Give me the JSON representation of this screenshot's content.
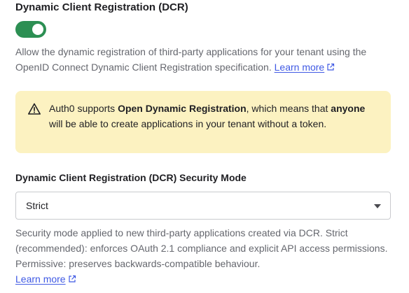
{
  "dcr": {
    "title": "Dynamic Client Registration (DCR)",
    "toggle_on": true,
    "description": "Allow the dynamic registration of third-party applications for your tenant using the OpenID Connect Dynamic Client Registration specification.",
    "learn_more": "Learn more"
  },
  "alert": {
    "icon": "warning-icon",
    "text_1": "Auth0 supports ",
    "bold_1": "Open Dynamic Registration",
    "text_2": ", which means that ",
    "bold_2": "anyone",
    "text_3": " will be able to create applications in your tenant without a token."
  },
  "security_mode": {
    "label": "Dynamic Client Registration (DCR) Security Mode",
    "selected": "Strict",
    "help": "Security mode applied to new third-party applications created via DCR. Strict (recommended): enforces OAuth 2.1 compliance and explicit API access permissions. Permissive: preserves backwards-compatible behaviour.",
    "learn_more": "Learn more"
  },
  "colors": {
    "toggle": "#2c8f53",
    "link": "#3f59e4",
    "alert_bg": "#fcf2c1"
  }
}
